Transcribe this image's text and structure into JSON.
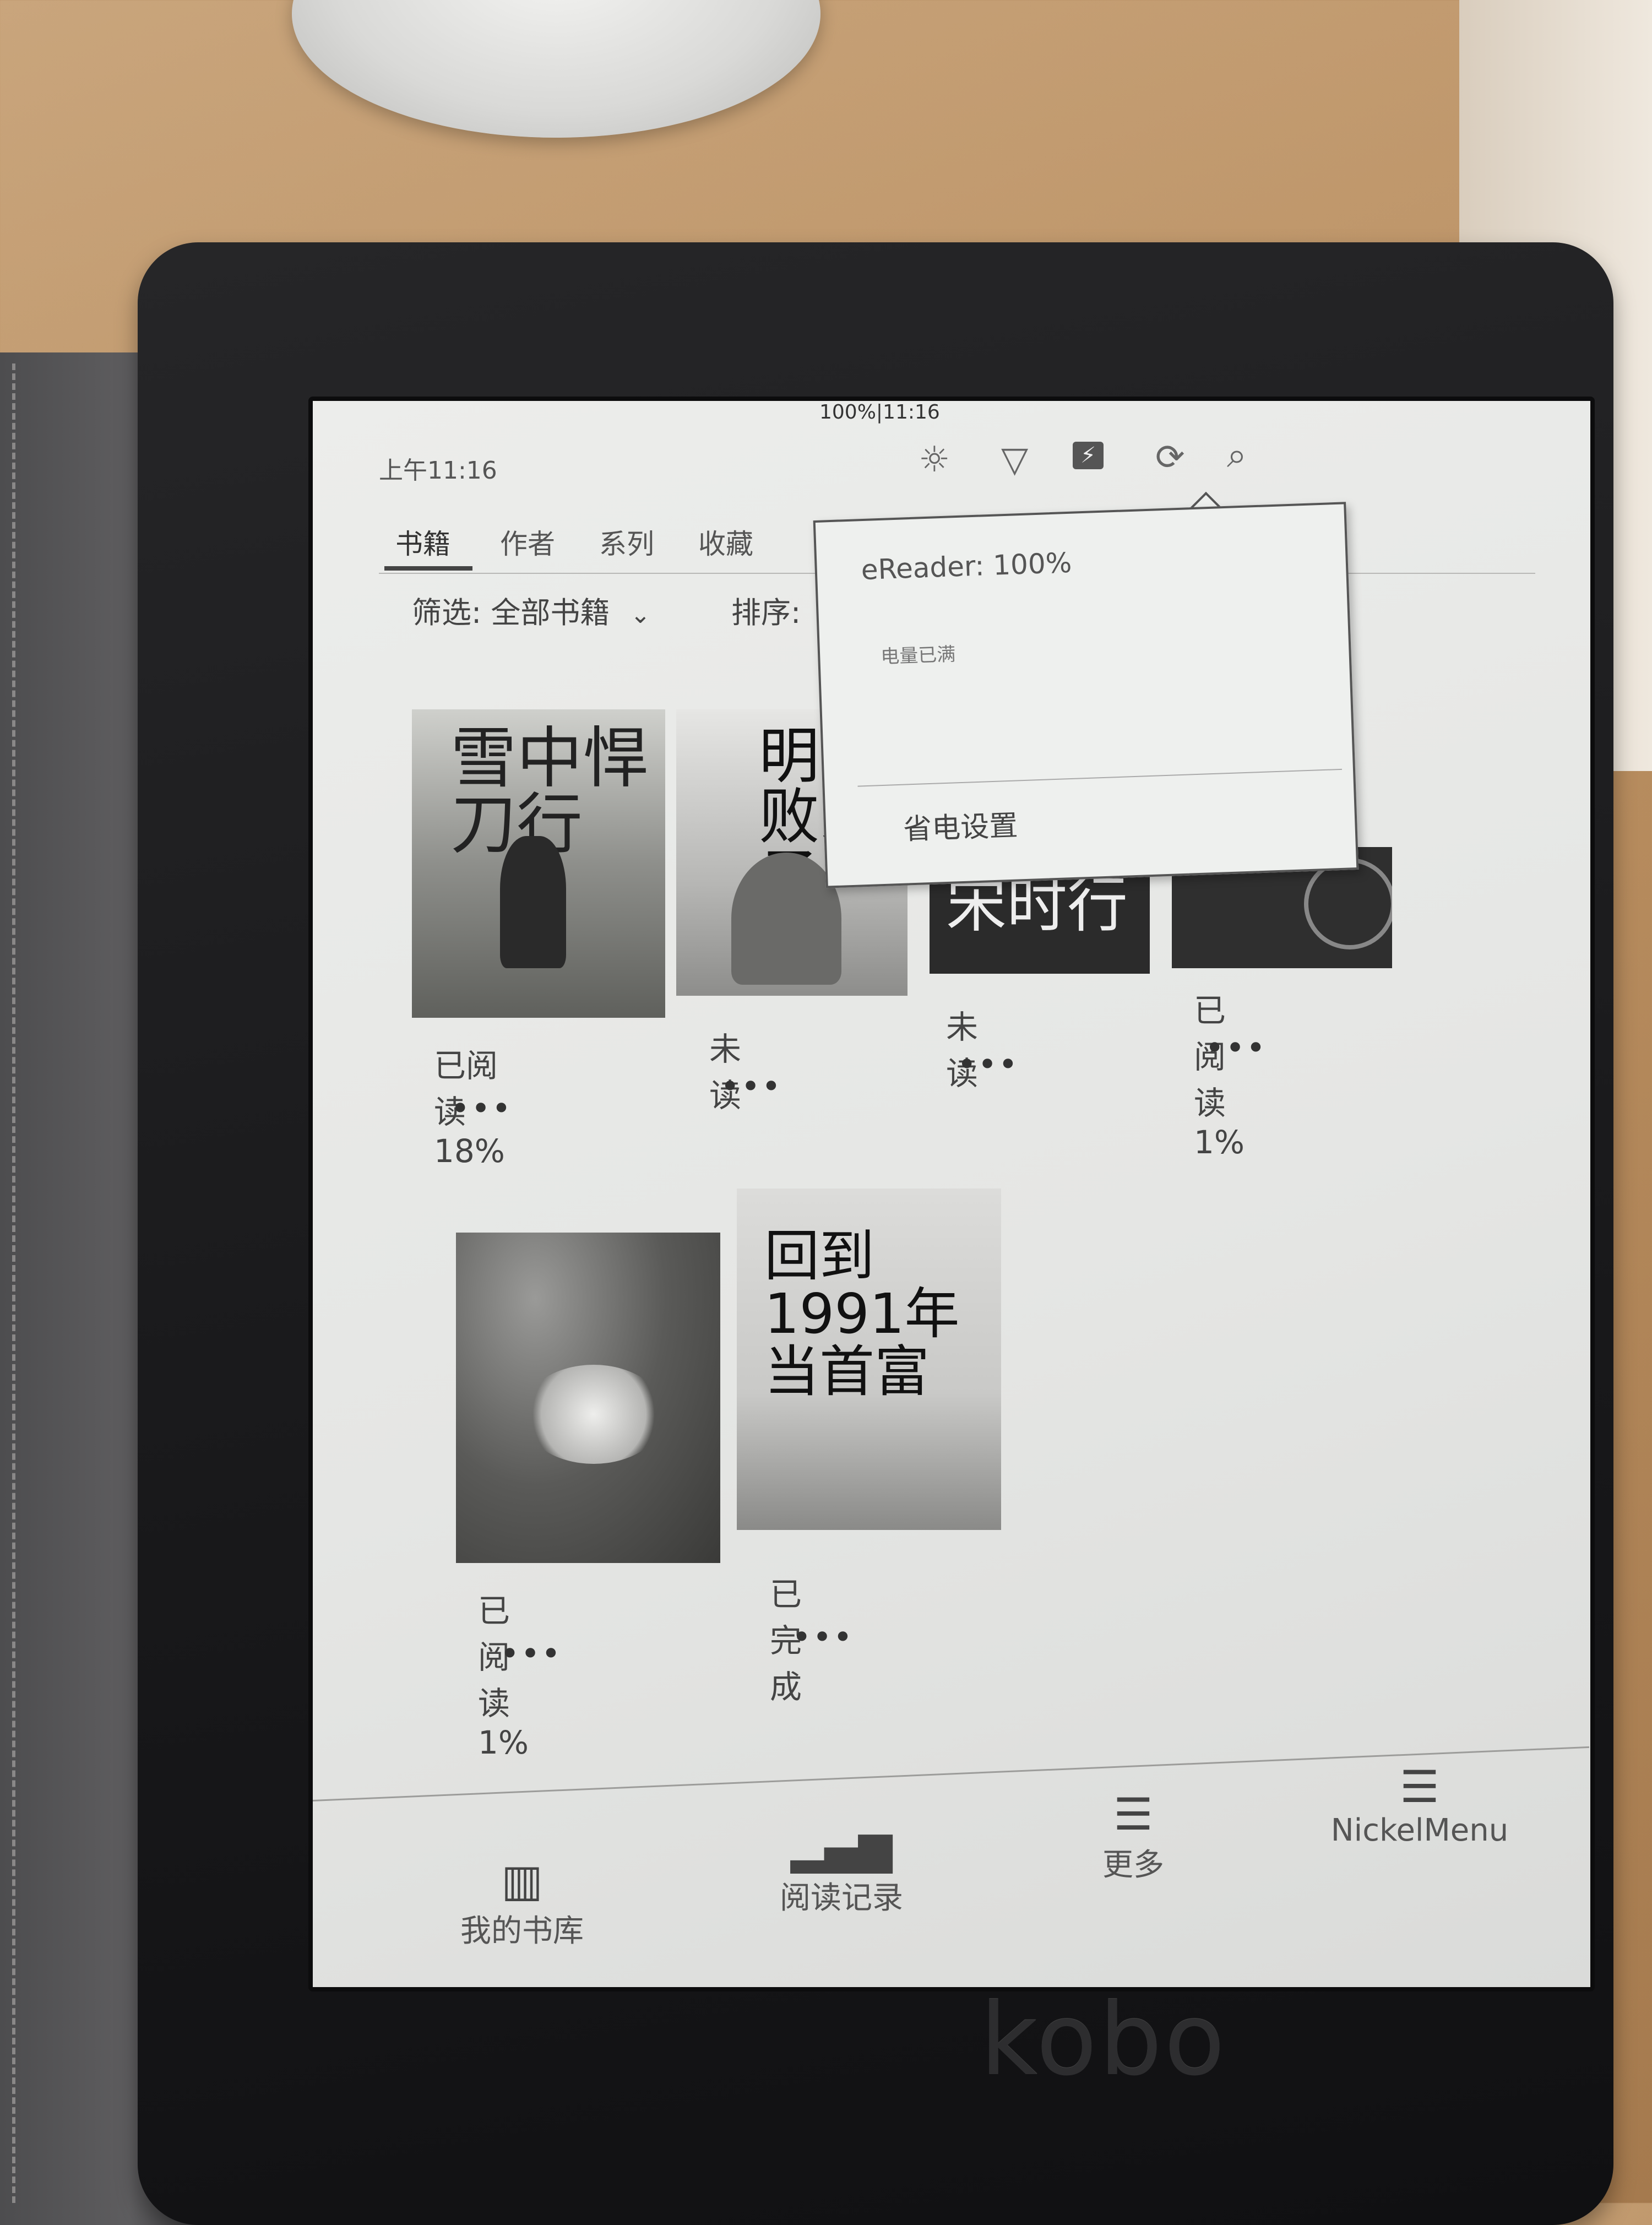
{
  "device": {
    "brand": "kobo"
  },
  "status_bar": {
    "top_center": "100%|11:16",
    "time": "上午11:16",
    "icons": [
      "brightness-icon",
      "wifi-icon",
      "battery-icon",
      "sync-icon",
      "search-icon"
    ]
  },
  "tabs": [
    {
      "label": "书籍",
      "active": true
    },
    {
      "label": "作者",
      "active": false
    },
    {
      "label": "系列",
      "active": false
    },
    {
      "label": "收藏",
      "active": false
    }
  ],
  "toolbar": {
    "filter_label": "筛选: 全部书籍",
    "filter_caret": "⌄",
    "sort_label": "排序:"
  },
  "battery_popup": {
    "title": "eReader: 100%",
    "subtitle": "电量已满",
    "button": "省电设置"
  },
  "books": [
    {
      "status": "已阅读 18%",
      "more": "•••",
      "cover_title": "雪中悍刀行"
    },
    {
      "status": "未读",
      "more": "•••",
      "cover_title": "明朝败家子"
    },
    {
      "status": "未读",
      "more": "•••",
      "cover_title": "宋时行"
    },
    {
      "status": "已阅读 1%",
      "more": "•••",
      "cover_title": ""
    },
    {
      "status": "已阅读 1%",
      "more": "•••",
      "cover_title": ""
    },
    {
      "status": "已完成",
      "more": "•••",
      "cover_title": "回到1991年当首富"
    }
  ],
  "bottom_nav": [
    {
      "label": "我的书库",
      "icon": "library-icon"
    },
    {
      "label": "阅读记录",
      "icon": "stats-icon"
    },
    {
      "label": "更多",
      "icon": "menu-icon"
    },
    {
      "label": "NickelMenu",
      "icon": "menu-icon"
    }
  ],
  "colors": {
    "screen": "#e8e9e7",
    "device": "#1a1a1c",
    "table": "#b88d5f"
  }
}
